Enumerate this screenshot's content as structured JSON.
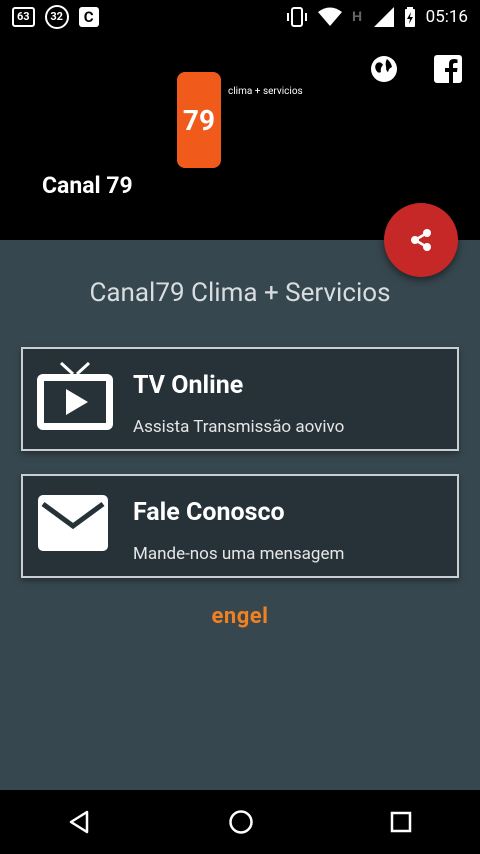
{
  "status_bar": {
    "badge_1": "63",
    "badge_2": "32",
    "badge_3": "C",
    "time": "05:16",
    "icons": [
      "vibrate-icon",
      "wifi-icon",
      "h-network-icon",
      "signal-icon",
      "battery-icon"
    ]
  },
  "header": {
    "logo_text": "79",
    "logo_tagline": "clima + servicios",
    "channel_title": "Canal 79",
    "icons": [
      "globe-icon",
      "facebook-icon"
    ]
  },
  "share_button": {
    "icon": "share-icon",
    "color": "#C62828"
  },
  "main": {
    "subtitle": "Canal79 Clima + Servicios",
    "cards": [
      {
        "title": "TV Online",
        "subtitle": "Assista Transmissão aovivo",
        "icon": "tv-play-icon"
      },
      {
        "title": "Fale Conosco",
        "subtitle": "Mande-nos uma mensagem",
        "icon": "envelope-icon"
      }
    ],
    "brand": "engel"
  },
  "colors": {
    "background": "#37474F",
    "card_background": "#263238",
    "accent": "#C62828",
    "brand_orange": "#F08020"
  },
  "navbar": {
    "icons": [
      "back-icon",
      "home-icon",
      "recents-icon"
    ]
  }
}
